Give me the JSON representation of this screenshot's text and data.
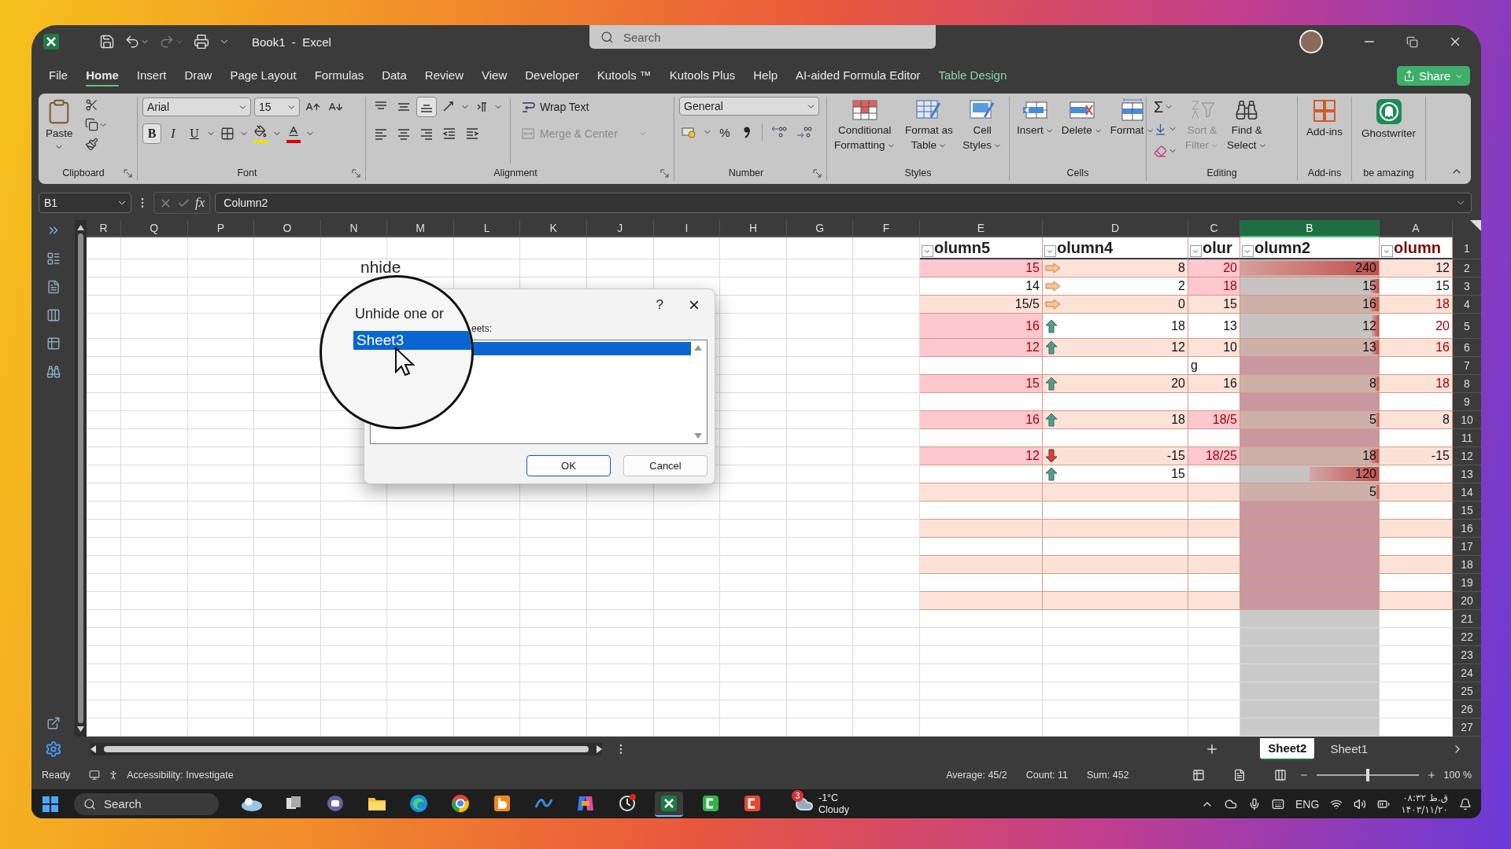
{
  "title_bar": {
    "title": "Book1  -  Excel",
    "search_placeholder": "Search"
  },
  "menu": [
    {
      "label": "File",
      "selected": false,
      "contextual": false
    },
    {
      "label": "Home",
      "selected": true,
      "contextual": false
    },
    {
      "label": "Insert",
      "selected": false,
      "contextual": false
    },
    {
      "label": "Draw",
      "selected": false,
      "contextual": false
    },
    {
      "label": "Page Layout",
      "selected": false,
      "contextual": false
    },
    {
      "label": "Formulas",
      "selected": false,
      "contextual": false
    },
    {
      "label": "Data",
      "selected": false,
      "contextual": false
    },
    {
      "label": "Review",
      "selected": false,
      "contextual": false
    },
    {
      "label": "View",
      "selected": false,
      "contextual": false
    },
    {
      "label": "Developer",
      "selected": false,
      "contextual": false
    },
    {
      "label": "Kutools ™",
      "selected": false,
      "contextual": false
    },
    {
      "label": "Kutools Plus",
      "selected": false,
      "contextual": false
    },
    {
      "label": "Help",
      "selected": false,
      "contextual": false
    },
    {
      "label": "AI-aided Formula Editor",
      "selected": false,
      "contextual": false
    },
    {
      "label": "Table Design",
      "selected": false,
      "contextual": true
    }
  ],
  "share": "Share",
  "ribbon": {
    "clipboard": {
      "label": "Clipboard",
      "paste": "Paste"
    },
    "font": {
      "label": "Font",
      "name": "Arial",
      "size": "15",
      "bold": "B",
      "italic": "I",
      "underline": "U"
    },
    "alignment": {
      "label": "Alignment",
      "vertical_align": [
        {
          "selected": false
        },
        {
          "selected": false
        },
        {
          "selected": true
        }
      ],
      "wrap": "Wrap Text",
      "merge": "Merge & Center",
      "merge_disabled": true
    },
    "number": {
      "label": "Number",
      "format": "General",
      "percent": "%"
    },
    "styles": {
      "label": "Styles",
      "buttons": [
        {
          "lines": [
            "Conditional",
            "Formatting"
          ],
          "menu": true,
          "disabled": false
        },
        {
          "lines": [
            "Format as",
            "Table"
          ],
          "menu": true,
          "disabled": false
        },
        {
          "lines": [
            "Cell",
            "Styles"
          ],
          "menu": true,
          "disabled": false
        }
      ]
    },
    "cells": {
      "label": "Cells",
      "buttons": [
        {
          "lines": [
            "Insert"
          ],
          "menu": true,
          "disabled": false
        },
        {
          "lines": [
            "Delete"
          ],
          "menu": true,
          "disabled": false
        },
        {
          "lines": [
            "Format"
          ],
          "menu": true,
          "disabled": false
        }
      ]
    },
    "editing": {
      "label": "Editing",
      "sum": "Σ",
      "buttons": [
        {
          "lines": [
            "Sort &",
            "Filter"
          ],
          "menu": true,
          "disabled": true
        },
        {
          "lines": [
            "Find &",
            "Select"
          ],
          "menu": true,
          "disabled": false
        }
      ]
    },
    "addins": {
      "label": "Add-ins",
      "buttons": [
        {
          "lines": [
            "Add-ins"
          ],
          "menu": false,
          "disabled": false
        }
      ]
    },
    "amazing": {
      "label": "be amazing",
      "buttons": [
        {
          "lines": [
            "Ghostwriter"
          ],
          "menu": false,
          "disabled": false
        }
      ]
    }
  },
  "formula_bar": {
    "name_box": "B1",
    "fx": "fx",
    "formula": "Column2"
  },
  "columns": [
    {
      "label": "R",
      "selected": false
    },
    {
      "label": "Q",
      "selected": false
    },
    {
      "label": "P",
      "selected": false
    },
    {
      "label": "O",
      "selected": false
    },
    {
      "label": "N",
      "selected": false
    },
    {
      "label": "M",
      "selected": false
    },
    {
      "label": "L",
      "selected": false
    },
    {
      "label": "K",
      "selected": false
    },
    {
      "label": "J",
      "selected": false
    },
    {
      "label": "I",
      "selected": false
    },
    {
      "label": "H",
      "selected": false
    },
    {
      "label": "G",
      "selected": false
    },
    {
      "label": "F",
      "selected": false
    },
    {
      "label": "E",
      "selected": false
    },
    {
      "label": "D",
      "selected": false
    },
    {
      "label": "C",
      "selected": false
    },
    {
      "label": "B",
      "selected": true
    },
    {
      "label": "A",
      "selected": false
    }
  ],
  "row_numbers": [
    "1",
    "2",
    "3",
    "4",
    "5",
    "6",
    "7",
    "8",
    "9",
    "10",
    "11",
    "12",
    "13",
    "14",
    "15",
    "16",
    "17",
    "18",
    "19",
    "20",
    "21",
    "22",
    "23",
    "24",
    "25",
    "26",
    "27"
  ],
  "table": {
    "headers": [
      {
        "text": "olumn5",
        "kind": "plain"
      },
      {
        "text": "olumn4",
        "kind": "plain"
      },
      {
        "text": "olur",
        "kind": "plain"
      },
      {
        "text": "olumn2",
        "kind": "plain"
      },
      {
        "text": "olumn",
        "kind": "font"
      }
    ],
    "rows": [
      {
        "banded": true,
        "cells": [
          {
            "text": "15",
            "kind": "fill"
          },
          {
            "text": "8",
            "kind": "right"
          },
          {
            "text": "20",
            "kind": "fill"
          },
          {
            "text": "240",
            "level": 1,
            "kind": "plain"
          },
          {
            "text": "12",
            "kind": "plain"
          }
        ]
      },
      {
        "banded": false,
        "cells": [
          {
            "text": "14",
            "kind": "plain"
          },
          {
            "text": "2",
            "kind": "right"
          },
          {
            "text": "18",
            "kind": "fill"
          },
          {
            "text": "15",
            "level": 0.06,
            "kind": "plain"
          },
          {
            "text": "15",
            "kind": "plain"
          }
        ]
      },
      {
        "banded": true,
        "cells": [
          {
            "text": "15/5",
            "kind": "plain"
          },
          {
            "text": "0",
            "kind": "right"
          },
          {
            "text": "15",
            "kind": "plain"
          },
          {
            "text": "16",
            "level": 0.07,
            "kind": "plain"
          },
          {
            "text": "18",
            "kind": "font"
          }
        ]
      },
      {
        "banded": false,
        "cells": [
          {
            "text": "16",
            "kind": "fill"
          },
          {
            "text": "18",
            "kind": "up"
          },
          {
            "text": "13",
            "kind": "plain"
          },
          {
            "text": "12",
            "level": 0.05,
            "kind": "plain"
          },
          {
            "text": "20",
            "kind": "font"
          }
        ]
      },
      {
        "banded": true,
        "cells": [
          {
            "text": "12",
            "kind": "fill"
          },
          {
            "text": "12",
            "kind": "up"
          },
          {
            "text": "10",
            "kind": "plain"
          },
          {
            "text": "13",
            "level": 0.05,
            "kind": "plain"
          },
          {
            "text": "16",
            "kind": "font"
          }
        ]
      },
      {
        "banded": false,
        "cells": [
          {
            "kind": "plain"
          },
          {
            "kind": "plain"
          },
          {
            "text": "g",
            "kind": "left"
          },
          {
            "kind": "plain"
          },
          {
            "kind": "plain"
          }
        ]
      },
      {
        "banded": true,
        "cells": [
          {
            "text": "15",
            "kind": "fill"
          },
          {
            "text": "20",
            "kind": "up"
          },
          {
            "text": "16",
            "kind": "plain"
          },
          {
            "text": "8",
            "level": 0.03,
            "kind": "plain"
          },
          {
            "text": "18",
            "kind": "font"
          }
        ]
      },
      {
        "banded": false,
        "cells": [
          {
            "kind": "plain"
          },
          {
            "kind": "plain"
          },
          {
            "kind": "plain"
          },
          {
            "kind": "plain"
          },
          {
            "kind": "plain"
          }
        ]
      },
      {
        "banded": true,
        "cells": [
          {
            "text": "16",
            "kind": "fill"
          },
          {
            "text": "18",
            "kind": "up"
          },
          {
            "text": "18/5",
            "kind": "fill"
          },
          {
            "text": "5",
            "level": 0.02,
            "kind": "plain"
          },
          {
            "text": "8",
            "kind": "plain"
          }
        ]
      },
      {
        "banded": false,
        "cells": [
          {
            "kind": "plain"
          },
          {
            "kind": "plain"
          },
          {
            "kind": "plain"
          },
          {
            "kind": "plain"
          },
          {
            "kind": "plain"
          }
        ]
      },
      {
        "banded": true,
        "cells": [
          {
            "text": "12",
            "kind": "fill"
          },
          {
            "text": "-15",
            "kind": "down"
          },
          {
            "text": "18/25",
            "kind": "fill"
          },
          {
            "text": "18",
            "level": 0.07,
            "kind": "plain"
          },
          {
            "text": "-15",
            "kind": "plain"
          }
        ]
      },
      {
        "banded": false,
        "cells": [
          {
            "kind": "plain"
          },
          {
            "text": "15",
            "kind": "up"
          },
          {
            "kind": "plain"
          },
          {
            "text": "120",
            "level": 0.5,
            "kind": "plain"
          },
          {
            "kind": "plain"
          }
        ]
      },
      {
        "banded": true,
        "cells": [
          {
            "kind": "plain"
          },
          {
            "kind": "plain"
          },
          {
            "kind": "plain"
          },
          {
            "text": "5",
            "level": 0.02,
            "kind": "plain"
          },
          {
            "kind": "plain"
          }
        ]
      },
      {
        "banded": false,
        "cells": [
          {
            "kind": "plain"
          },
          {
            "kind": "plain"
          },
          {
            "kind": "plain"
          },
          {
            "kind": "plain"
          },
          {
            "kind": "plain"
          }
        ]
      },
      {
        "banded": true,
        "cells": [
          {
            "kind": "plain"
          },
          {
            "kind": "plain"
          },
          {
            "kind": "plain"
          },
          {
            "kind": "plain"
          },
          {
            "kind": "plain"
          }
        ]
      },
      {
        "banded": false,
        "cells": [
          {
            "kind": "plain"
          },
          {
            "kind": "plain"
          },
          {
            "kind": "plain"
          },
          {
            "kind": "plain"
          },
          {
            "kind": "plain"
          }
        ]
      },
      {
        "banded": true,
        "cells": [
          {
            "kind": "plain"
          },
          {
            "kind": "plain"
          },
          {
            "kind": "plain"
          },
          {
            "kind": "plain"
          },
          {
            "kind": "plain"
          }
        ]
      },
      {
        "banded": false,
        "cells": [
          {
            "kind": "plain"
          },
          {
            "kind": "plain"
          },
          {
            "kind": "plain"
          },
          {
            "kind": "plain"
          },
          {
            "kind": "plain"
          }
        ]
      },
      {
        "banded": true,
        "cells": [
          {
            "kind": "plain"
          },
          {
            "kind": "plain"
          },
          {
            "kind": "plain"
          },
          {
            "kind": "plain"
          },
          {
            "kind": "plain"
          }
        ]
      }
    ]
  },
  "dialog": {
    "help": "?",
    "close": "×",
    "label": "eets:",
    "items": [
      {
        "label": "Sheet3",
        "selected": true
      }
    ],
    "buttons": [
      {
        "label": "OK",
        "default": true
      },
      {
        "label": "Cancel",
        "default": false
      }
    ]
  },
  "magnifier": {
    "title": "nhide",
    "label": "Unhide one or"
  },
  "sheet_tabs": [
    {
      "label": "Sheet2",
      "selected": true
    },
    {
      "label": "Sheet1",
      "selected": false
    }
  ],
  "status_bar": {
    "mode": "Ready",
    "accessibility": "Accessibility: Investigate",
    "average": "Average: 45/2",
    "count": "Count: 11",
    "sum": "Sum: 452",
    "zoom": "100 %",
    "zoom_slider": {
      "level": 0.5
    }
  },
  "taskbar": {
    "search_placeholder": "Search",
    "apps": [
      {
        "kind": "widgets",
        "active": false
      },
      {
        "kind": "taskview",
        "active": false
      },
      {
        "kind": "chat",
        "active": false
      },
      {
        "kind": "folder",
        "active": false
      },
      {
        "kind": "edge",
        "active": false
      },
      {
        "kind": "chrome",
        "active": false
      },
      {
        "kind": "orange",
        "active": false
      },
      {
        "kind": "script",
        "active": false
      },
      {
        "kind": "copilot",
        "active": false
      },
      {
        "kind": "clock",
        "active": false
      },
      {
        "kind": "excel",
        "active": true
      },
      {
        "kind": "green",
        "active": false
      },
      {
        "kind": "red",
        "active": false
      }
    ],
    "weather": {
      "badge": "3",
      "temperature": "-1°C",
      "condition": "Cloudy"
    },
    "language": "ENG",
    "time": "۰۸:۳۲ ق.ظ",
    "date": "۱۴۰۳/۱۱/۲۰"
  }
}
